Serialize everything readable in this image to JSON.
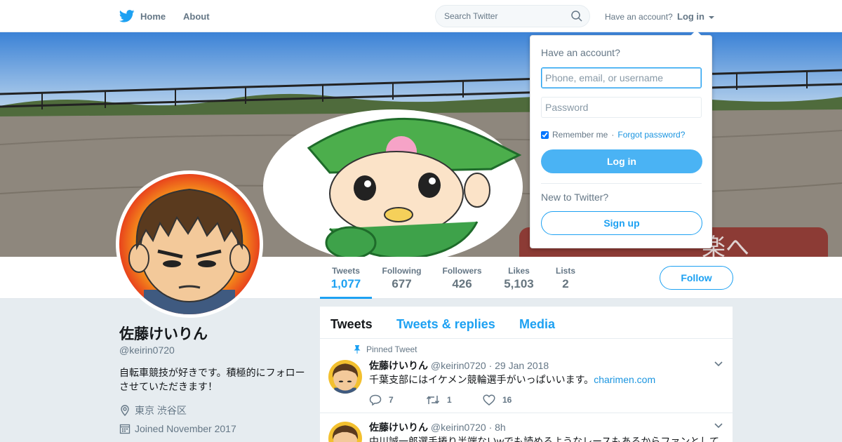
{
  "nav": {
    "home_label": "Home",
    "about_label": "About",
    "search_placeholder": "Search Twitter",
    "have_account": "Have an account?",
    "login_label": "Log in"
  },
  "profile": {
    "name": "佐藤けいりん",
    "handle": "@keirin0720",
    "bio": "自転車競技が好きです。積極的にフォローさせていただきます！",
    "location": "東京 渋谷区",
    "joined": "Joined November 2017",
    "follow_label": "Follow"
  },
  "stats": [
    {
      "label": "Tweets",
      "value": "1,077"
    },
    {
      "label": "Following",
      "value": "677"
    },
    {
      "label": "Followers",
      "value": "426"
    },
    {
      "label": "Likes",
      "value": "5,103"
    },
    {
      "label": "Lists",
      "value": "2"
    }
  ],
  "timeline": {
    "tabs": [
      "Tweets",
      "Tweets & replies",
      "Media"
    ],
    "tweets": [
      {
        "pinned_label": "Pinned Tweet",
        "name": "佐藤けいりん",
        "meta": "@keirin0720 · 29 Jan 2018",
        "text": "千葉支部にはイケメン競輪選手がいっぱいいます。",
        "link": "charimen.com",
        "replies": "7",
        "retweets": "1",
        "likes": "16"
      },
      {
        "name": "佐藤けいりん",
        "meta": "@keirin0720 · 8h",
        "text": "中川誠一郎選手捲り半端ないwでも読めるようなレースもあるからファンとして"
      }
    ]
  },
  "login": {
    "title": "Have an account?",
    "username_placeholder": "Phone, email, or username",
    "password_placeholder": "Password",
    "remember": "Remember me",
    "separator": "·",
    "forgot": "Forgot password?",
    "login_button": "Log in",
    "new_to": "New to Twitter?",
    "signup_button": "Sign up"
  },
  "colors": {
    "accent": "#1da1f2",
    "login_button": "#4ab3f4",
    "background": "#e6ecf0"
  }
}
